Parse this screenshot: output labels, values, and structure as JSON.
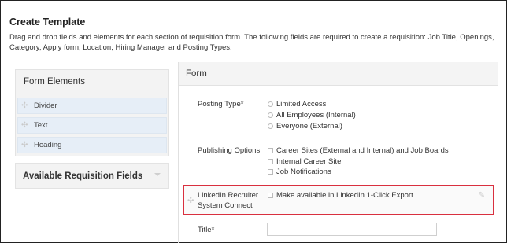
{
  "page": {
    "title": "Create Template",
    "description": "Drag and drop fields and elements for each section of requisition form. The following fields are required to create a requisition: Job Title, Openings, Category, Apply form, Location, Hiring Manager and Posting Types."
  },
  "form_elements": {
    "title": "Form Elements",
    "items": [
      {
        "label": "Divider",
        "icon": "drag-handle-icon"
      },
      {
        "label": "Text",
        "icon": "drag-handle-icon"
      },
      {
        "label": "Heading",
        "icon": "drag-handle-icon"
      }
    ]
  },
  "available_fields": {
    "title": "Available Requisition Fields",
    "icon": "chevron-down-icon"
  },
  "form": {
    "title": "Form",
    "posting_type": {
      "label": "Posting Type*",
      "options": [
        "Limited Access",
        "All Employees (Internal)",
        "Everyone (External)"
      ]
    },
    "publishing_options": {
      "label": "Publishing Options",
      "options": [
        "Career Sites (External and Internal) and Job Boards",
        "Internal Career Site",
        "Job Notifications"
      ]
    },
    "linkedin": {
      "label_line1": "LinkedIn Recruiter",
      "label_line2": "System Connect",
      "option": "Make available in LinkedIn 1-Click Export",
      "icons": [
        "drag-handle-icon",
        "pencil-icon"
      ],
      "highlight_color": "#d9303f"
    },
    "title_field": {
      "label": "Title*",
      "value": ""
    }
  }
}
